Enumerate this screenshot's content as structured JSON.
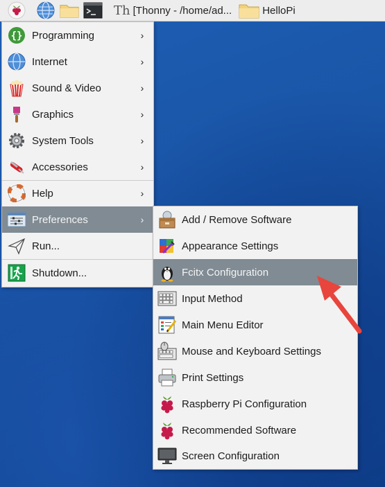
{
  "taskbar": {
    "thonny_label": "[Thonny  -  /home/ad...",
    "hellopi_label": "HelloPi"
  },
  "main_menu": {
    "items": [
      {
        "label": "Programming",
        "icon": "code-braces-icon"
      },
      {
        "label": "Internet",
        "icon": "globe-icon"
      },
      {
        "label": "Sound & Video",
        "icon": "popcorn-icon"
      },
      {
        "label": "Graphics",
        "icon": "paintbrush-icon"
      },
      {
        "label": "System Tools",
        "icon": "gear-icon"
      },
      {
        "label": "Accessories",
        "icon": "swiss-knife-icon"
      },
      {
        "label": "Help",
        "icon": "lifebuoy-icon"
      },
      {
        "label": "Preferences",
        "icon": "preferences-sliders-icon"
      },
      {
        "label": "Run...",
        "icon": "paper-plane-icon"
      },
      {
        "label": "Shutdown...",
        "icon": "exit-running-man-icon"
      }
    ],
    "arrow_glyph": "›"
  },
  "sub_menu": {
    "items": [
      {
        "label": "Add / Remove Software",
        "icon": "package-icon"
      },
      {
        "label": "Appearance Settings",
        "icon": "palette-icon"
      },
      {
        "label": "Fcitx Configuration",
        "icon": "penguin-icon"
      },
      {
        "label": "Input Method",
        "icon": "keyboard-icon"
      },
      {
        "label": "Main Menu Editor",
        "icon": "menu-editor-icon"
      },
      {
        "label": "Mouse and Keyboard Settings",
        "icon": "mouse-keyboard-icon"
      },
      {
        "label": "Print Settings",
        "icon": "printer-icon"
      },
      {
        "label": "Raspberry Pi Configuration",
        "icon": "raspberry-icon"
      },
      {
        "label": "Recommended Software",
        "icon": "raspberry-icon"
      },
      {
        "label": "Screen Configuration",
        "icon": "monitor-icon"
      }
    ]
  },
  "colors": {
    "highlight": "#808b93",
    "menu_bg": "#f2f2f2",
    "desktop": "#1a55a7",
    "annotation_arrow": "#e8453c"
  }
}
